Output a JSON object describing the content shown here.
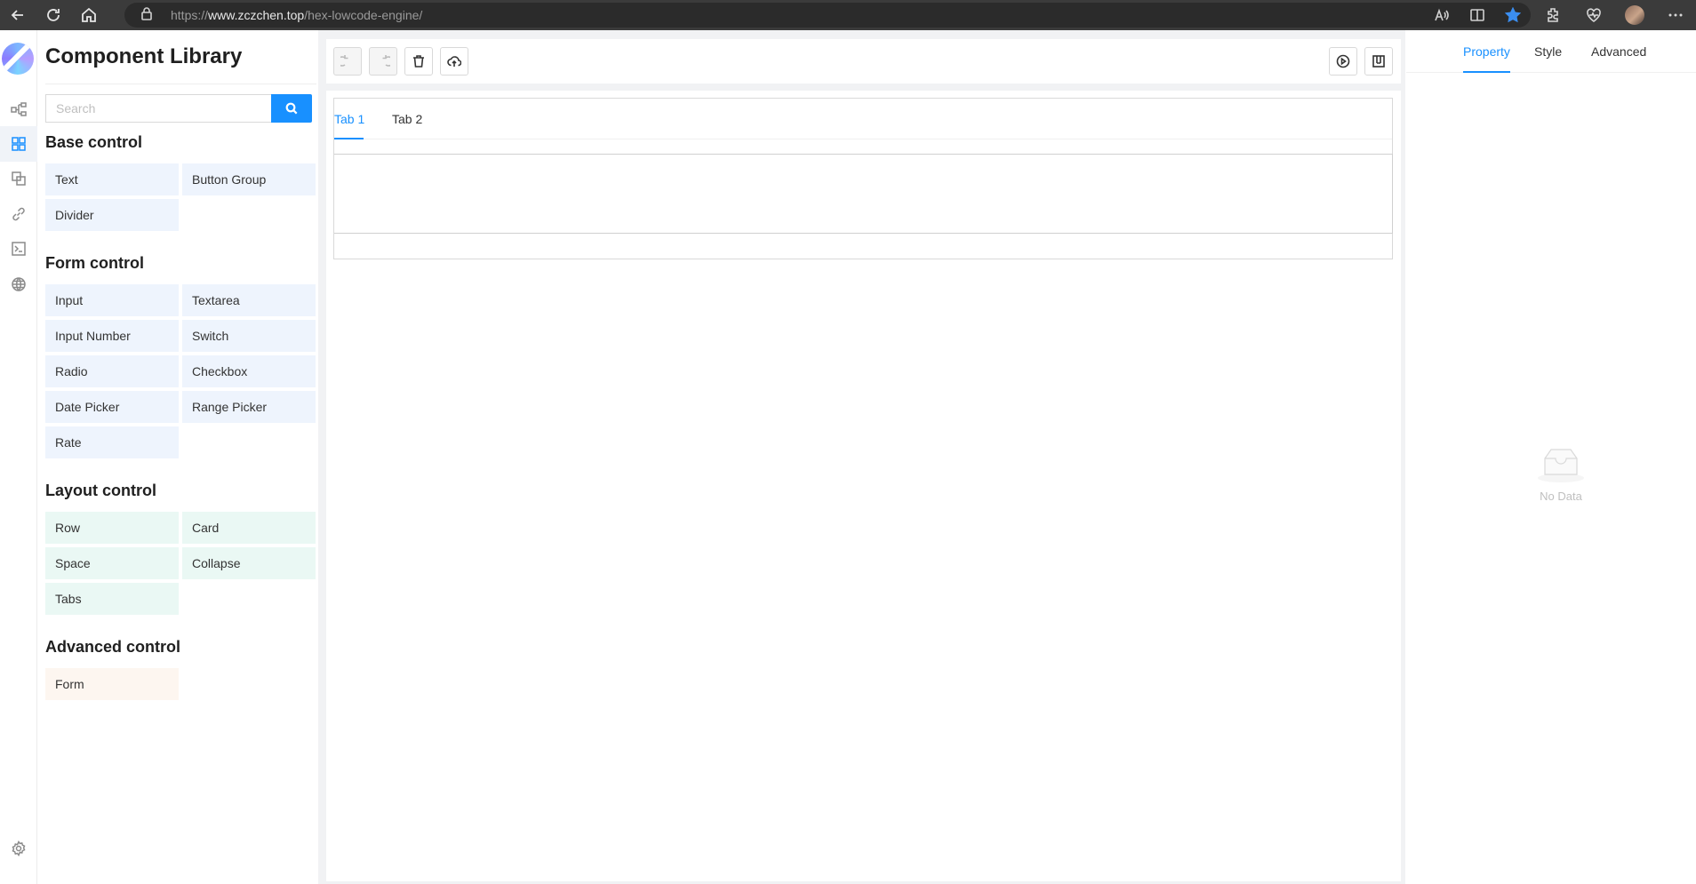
{
  "browser": {
    "url_prefix": "https://",
    "url_domain": "www.zczchen.top",
    "url_path": "/hex-lowcode-engine/"
  },
  "library": {
    "title": "Component Library",
    "search_placeholder": "Search",
    "groups": [
      {
        "title": "Base control",
        "items": [
          "Text",
          "Button Group",
          "Divider"
        ]
      },
      {
        "title": "Form control",
        "items": [
          "Input",
          "Textarea",
          "Input Number",
          "Switch",
          "Radio",
          "Checkbox",
          "Date Picker",
          "Range Picker",
          "Rate"
        ]
      },
      {
        "title": "Layout control",
        "items": [
          "Row",
          "Card",
          "Space",
          "Collapse",
          "Tabs"
        ]
      },
      {
        "title": "Advanced control",
        "items": [
          "Form"
        ]
      }
    ]
  },
  "canvas": {
    "tabs": [
      "Tab 1",
      "Tab 2"
    ],
    "active_tab": "Tab 1"
  },
  "properties": {
    "tabs": [
      "Property",
      "Style",
      "Advanced"
    ],
    "active_tab": "Property",
    "empty_text": "No Data"
  },
  "colors": {
    "accent": "#1890ff",
    "base_item_bg": "#eef4fd",
    "layout_item_bg": "#eaf8f4",
    "advanced_item_bg": "#fdf6f0"
  }
}
